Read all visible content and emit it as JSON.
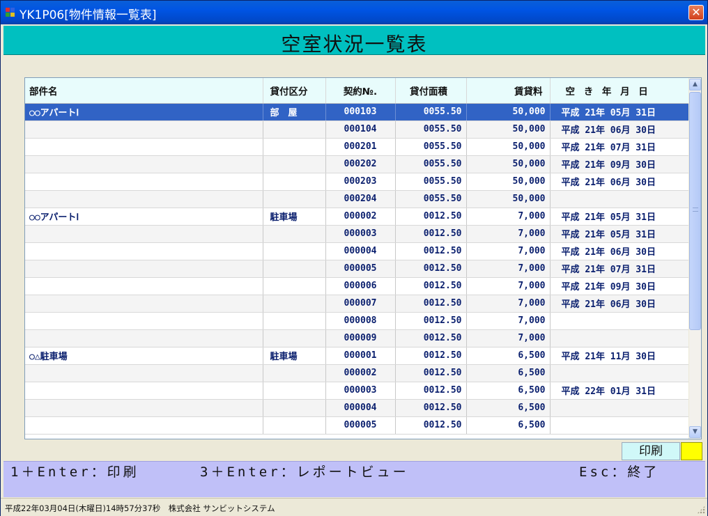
{
  "window": {
    "title": "YK1P06[物件情報一覧表]",
    "close_glyph": "✕"
  },
  "header": {
    "title": "空室状況一覧表"
  },
  "table": {
    "columns": [
      "部件名",
      "貸付区分",
      "契約№.",
      "貸付面積",
      "賃貸料",
      "空 き 年 月 日"
    ],
    "rows": [
      {
        "name": "○○アパートⅠ",
        "type": "部　屋",
        "contract": "000103",
        "area": "0055.50",
        "rent": "50,000",
        "date": "平成 21年 05月 31日",
        "selected": true
      },
      {
        "name": "",
        "type": "",
        "contract": "000104",
        "area": "0055.50",
        "rent": "50,000",
        "date": "平成 21年 06月 30日"
      },
      {
        "name": "",
        "type": "",
        "contract": "000201",
        "area": "0055.50",
        "rent": "50,000",
        "date": "平成 21年 07月 31日"
      },
      {
        "name": "",
        "type": "",
        "contract": "000202",
        "area": "0055.50",
        "rent": "50,000",
        "date": "平成 21年 09月 30日"
      },
      {
        "name": "",
        "type": "",
        "contract": "000203",
        "area": "0055.50",
        "rent": "50,000",
        "date": "平成 21年 06月 30日"
      },
      {
        "name": "",
        "type": "",
        "contract": "000204",
        "area": "0055.50",
        "rent": "50,000",
        "date": ""
      },
      {
        "name": "○○アパートⅠ",
        "type": "駐車場",
        "contract": "000002",
        "area": "0012.50",
        "rent": "7,000",
        "date": "平成 21年 05月 31日"
      },
      {
        "name": "",
        "type": "",
        "contract": "000003",
        "area": "0012.50",
        "rent": "7,000",
        "date": "平成 21年 05月 31日"
      },
      {
        "name": "",
        "type": "",
        "contract": "000004",
        "area": "0012.50",
        "rent": "7,000",
        "date": "平成 21年 06月 30日"
      },
      {
        "name": "",
        "type": "",
        "contract": "000005",
        "area": "0012.50",
        "rent": "7,000",
        "date": "平成 21年 07月 31日"
      },
      {
        "name": "",
        "type": "",
        "contract": "000006",
        "area": "0012.50",
        "rent": "7,000",
        "date": "平成 21年 09月 30日"
      },
      {
        "name": "",
        "type": "",
        "contract": "000007",
        "area": "0012.50",
        "rent": "7,000",
        "date": "平成 21年 06月 30日"
      },
      {
        "name": "",
        "type": "",
        "contract": "000008",
        "area": "0012.50",
        "rent": "7,000",
        "date": ""
      },
      {
        "name": "",
        "type": "",
        "contract": "000009",
        "area": "0012.50",
        "rent": "7,000",
        "date": ""
      },
      {
        "name": "○△駐車場",
        "type": "駐車場",
        "contract": "000001",
        "area": "0012.50",
        "rent": "6,500",
        "date": "平成 21年 11月 30日"
      },
      {
        "name": "",
        "type": "",
        "contract": "000002",
        "area": "0012.50",
        "rent": "6,500",
        "date": ""
      },
      {
        "name": "",
        "type": "",
        "contract": "000003",
        "area": "0012.50",
        "rent": "6,500",
        "date": "平成 22年 01月 31日"
      },
      {
        "name": "",
        "type": "",
        "contract": "000004",
        "area": "0012.50",
        "rent": "6,500",
        "date": ""
      },
      {
        "name": "",
        "type": "",
        "contract": "000005",
        "area": "0012.50",
        "rent": "6,500",
        "date": ""
      }
    ]
  },
  "print_label": "印刷",
  "keys": {
    "print": "1＋Enter：印刷",
    "report_view": "3＋Enter：レポートビュー",
    "exit": "Esc：終了"
  },
  "status": {
    "text": "平成22年03月04日(木曜日)14時57分37秒　株式会社 サンビットシステム"
  },
  "colors": {
    "header_bg": "#00c0c0",
    "selected_row": "#3163c5",
    "keybar_bg": "#c0c0f8",
    "print_swatch": "#ffff00"
  },
  "scrollbar": {
    "up_glyph": "▲",
    "down_glyph": "▼"
  }
}
